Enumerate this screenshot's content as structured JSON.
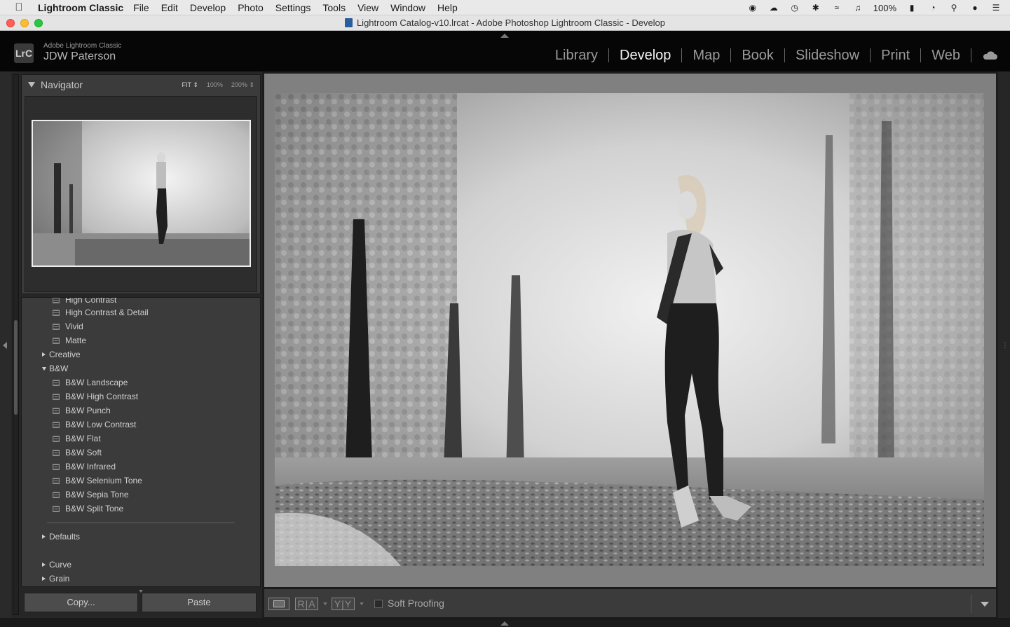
{
  "menubar": {
    "app_name": "Lightroom Classic",
    "items": [
      "File",
      "Edit",
      "Develop",
      "Photo",
      "Settings",
      "Tools",
      "View",
      "Window",
      "Help"
    ],
    "battery": "100%"
  },
  "window": {
    "title": "Lightroom Catalog-v10.lrcat - Adobe Photoshop Lightroom Classic - Develop"
  },
  "identity": {
    "badge": "LrC",
    "line1": "Adobe Lightroom Classic",
    "line2": "JDW Paterson"
  },
  "modules": [
    "Library",
    "Develop",
    "Map",
    "Book",
    "Slideshow",
    "Print",
    "Web"
  ],
  "active_module": "Develop",
  "navigator": {
    "title": "Navigator",
    "zoom_options": [
      "FIT",
      "100%",
      "200%"
    ],
    "active_zoom": "FIT"
  },
  "presets": {
    "partial_item": "High Contrast",
    "items_top": [
      "High Contrast & Detail",
      "Vivid",
      "Matte"
    ],
    "group_creative": "Creative",
    "group_bw": "B&W",
    "bw_items": [
      "B&W Landscape",
      "B&W High Contrast",
      "B&W Punch",
      "B&W Low Contrast",
      "B&W Flat",
      "B&W Soft",
      "B&W Infrared",
      "B&W Selenium Tone",
      "B&W Sepia Tone",
      "B&W Split Tone"
    ],
    "group_defaults": "Defaults",
    "group_curve": "Curve",
    "group_grain": "Grain"
  },
  "left_footer": {
    "copy_label": "Copy...",
    "paste_label": "Paste"
  },
  "toolbar": {
    "before_after_label": "R|A",
    "yy_label": "Y|Y",
    "soft_proofing_label": "Soft Proofing"
  },
  "colors": {
    "active_module": "#f2f2f2",
    "inactive_module": "#9a9a9a",
    "panel_bg": "#3b3b3b",
    "canvas_bg": "#808080"
  }
}
